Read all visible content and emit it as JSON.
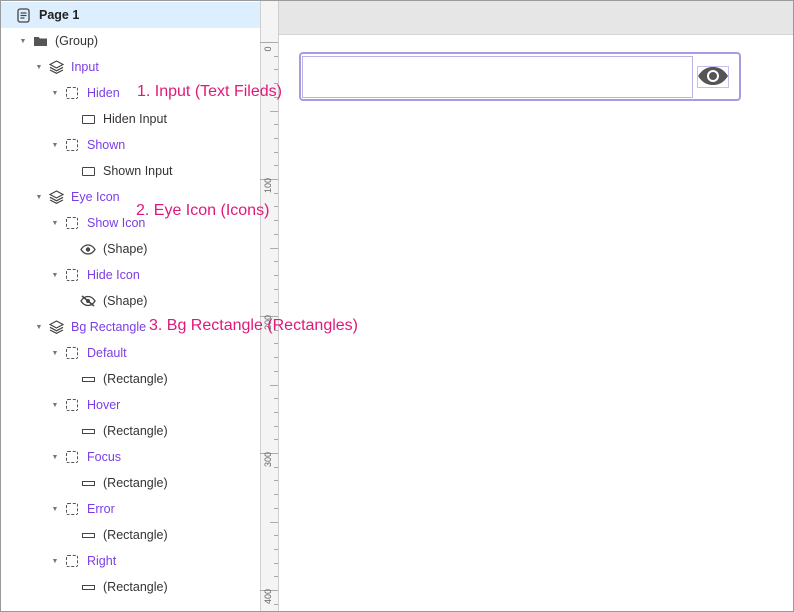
{
  "layers_panel": {
    "page": {
      "label": "Page 1",
      "icon": "page-icon"
    },
    "rows": [
      {
        "label": "(Group)",
        "icon": "folder-icon",
        "style": "normal"
      },
      {
        "label": "Input",
        "icon": "layers-icon",
        "style": "purple"
      },
      {
        "label": "Hiden",
        "icon": "dashed-frame-icon",
        "style": "purple"
      },
      {
        "label": "Hiden Input",
        "icon": "input-rect-icon",
        "style": "normal"
      },
      {
        "label": "Shown",
        "icon": "dashed-frame-icon",
        "style": "purple"
      },
      {
        "label": "Shown Input",
        "icon": "input-rect-icon",
        "style": "normal"
      },
      {
        "label": "Eye Icon",
        "icon": "layers-icon",
        "style": "purple"
      },
      {
        "label": "Show Icon",
        "icon": "dashed-frame-icon",
        "style": "purple"
      },
      {
        "label": "(Shape)",
        "icon": "eye-icon",
        "style": "normal"
      },
      {
        "label": "Hide Icon",
        "icon": "dashed-frame-icon",
        "style": "purple"
      },
      {
        "label": "(Shape)",
        "icon": "eye-slash-icon",
        "style": "normal"
      },
      {
        "label": "Bg Rectangle",
        "icon": "layers-icon",
        "style": "purple"
      },
      {
        "label": "Default",
        "icon": "dashed-frame-icon",
        "style": "purple"
      },
      {
        "label": "(Rectangle)",
        "icon": "rectangle-icon",
        "style": "normal"
      },
      {
        "label": "Hover",
        "icon": "dashed-frame-icon",
        "style": "purple"
      },
      {
        "label": "(Rectangle)",
        "icon": "rectangle-icon",
        "style": "normal"
      },
      {
        "label": "Focus",
        "icon": "dashed-frame-icon",
        "style": "purple"
      },
      {
        "label": "(Rectangle)",
        "icon": "rectangle-icon",
        "style": "normal"
      },
      {
        "label": "Error",
        "icon": "dashed-frame-icon",
        "style": "purple"
      },
      {
        "label": "(Rectangle)",
        "icon": "rectangle-icon",
        "style": "normal"
      },
      {
        "label": "Right",
        "icon": "dashed-frame-icon",
        "style": "purple"
      },
      {
        "label": "(Rectangle)",
        "icon": "rectangle-icon",
        "style": "normal"
      }
    ]
  },
  "ruler": {
    "labels": [
      "0",
      "100",
      "200",
      "300",
      "400"
    ]
  },
  "annotations": {
    "input": "1. Input (Text Fileds)",
    "eye_icon": "2. Eye Icon (Icons)",
    "bg_rectangle": "3. Bg Rectangle (Rectangles)"
  },
  "canvas": {
    "eye_button_icon": "eye-icon"
  },
  "colors": {
    "selected_row": "#ddefff",
    "purple_label": "#7b3ee6",
    "annotation": "#e0187a",
    "input_border": "#a79be4"
  }
}
